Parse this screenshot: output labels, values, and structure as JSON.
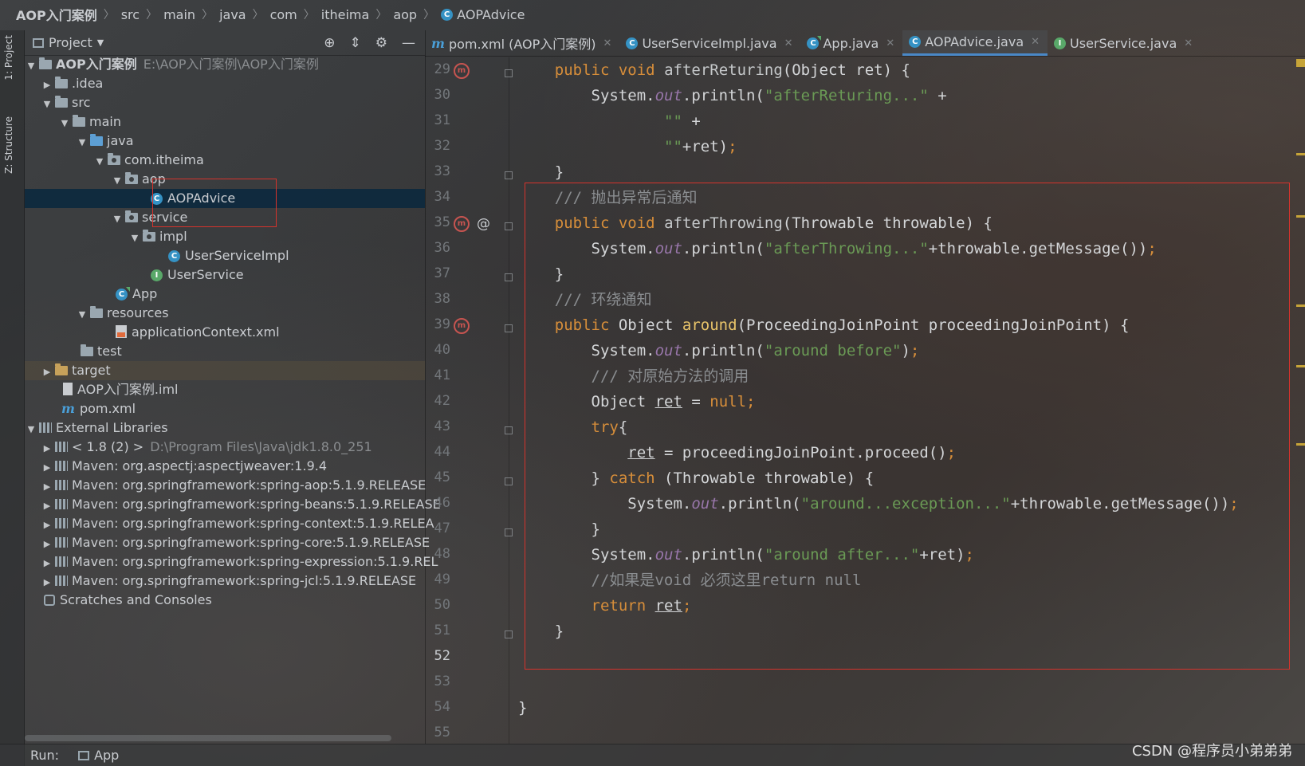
{
  "breadcrumb": [
    "AOP入门案例",
    "src",
    "main",
    "java",
    "com",
    "itheima",
    "aop",
    "AOPAdvice"
  ],
  "tool_stripe": {
    "project_label": "1: Project",
    "structure_label": "Z: Structure"
  },
  "project_panel": {
    "title": "Project",
    "tree": [
      {
        "label": "AOP入门案例",
        "path": "E:\\AOP入门案例\\AOP入门案例"
      },
      {
        "label": ".idea"
      },
      {
        "label": "src"
      },
      {
        "label": "main"
      },
      {
        "label": "java"
      },
      {
        "label": "com.itheima"
      },
      {
        "label": "aop"
      },
      {
        "label": "AOPAdvice"
      },
      {
        "label": "service"
      },
      {
        "label": "impl"
      },
      {
        "label": "UserServiceImpl"
      },
      {
        "label": "UserService"
      },
      {
        "label": "App"
      },
      {
        "label": "resources"
      },
      {
        "label": "applicationContext.xml"
      },
      {
        "label": "test"
      },
      {
        "label": "target"
      },
      {
        "label": "AOP入门案例.iml"
      },
      {
        "label": "pom.xml"
      },
      {
        "label": "External Libraries"
      },
      {
        "label": "< 1.8 (2) >",
        "path": "D:\\Program Files\\Java\\jdk1.8.0_251"
      },
      {
        "label": "Maven: org.aspectj:aspectjweaver:1.9.4"
      },
      {
        "label": "Maven: org.springframework:spring-aop:5.1.9.RELEASE"
      },
      {
        "label": "Maven: org.springframework:spring-beans:5.1.9.RELEASE"
      },
      {
        "label": "Maven: org.springframework:spring-context:5.1.9.RELEA"
      },
      {
        "label": "Maven: org.springframework:spring-core:5.1.9.RELEASE"
      },
      {
        "label": "Maven: org.springframework:spring-expression:5.1.9.REL"
      },
      {
        "label": "Maven: org.springframework:spring-jcl:5.1.9.RELEASE"
      },
      {
        "label": "Scratches and Consoles"
      }
    ]
  },
  "tabs": [
    {
      "label": "pom.xml (AOP入门案例)",
      "icon": "maven-icon"
    },
    {
      "label": "UserServiceImpl.java",
      "icon": "class-icon"
    },
    {
      "label": "App.java",
      "icon": "app-class-icon"
    },
    {
      "label": "AOPAdvice.java",
      "icon": "class-icon",
      "active": true
    },
    {
      "label": "UserService.java",
      "icon": "interface-icon"
    }
  ],
  "editor": {
    "line_numbers": [
      "29",
      "30",
      "31",
      "32",
      "33",
      "34",
      "35",
      "36",
      "37",
      "38",
      "39",
      "40",
      "41",
      "42",
      "43",
      "44",
      "45",
      "46",
      "47",
      "48",
      "49",
      "50",
      "51",
      "52",
      "53",
      "54",
      "55"
    ],
    "current_line": "52",
    "code_lines": [
      "    public void afterReturing(Object ret) {",
      "        System.out.println(\"afterReturing...\" +",
      "                \"\" +",
      "                \"\"+ret);",
      "    }",
      "    /// 抛出异常后通知",
      "    public void afterThrowing(Throwable throwable) {",
      "        System.out.println(\"afterThrowing...\"+throwable.getMessage());",
      "    }",
      "    /// 环绕通知",
      "    public Object around(ProceedingJoinPoint proceedingJoinPoint) {",
      "        System.out.println(\"around before\");",
      "        /// 对原始方法的调用",
      "        Object ret = null;",
      "        try{",
      "            ret = proceedingJoinPoint.proceed();",
      "        } catch (Throwable throwable) {",
      "            System.out.println(\"around...exception...\"+throwable.getMessage());",
      "        }",
      "        System.out.println(\"around after...\"+ret);",
      "        //如果是void 必须这里return null",
      "        return ret;",
      "    }",
      "",
      "",
      "}",
      ""
    ]
  },
  "status_bar": {
    "run_label": "Run:",
    "run_config": "App"
  },
  "watermark": "CSDN @程序员小弟弟弟",
  "colors": {
    "selection": "#0d293e",
    "annotation_red": "#d6332c",
    "keyword": "#d78e3a",
    "string": "#6a9a55"
  }
}
